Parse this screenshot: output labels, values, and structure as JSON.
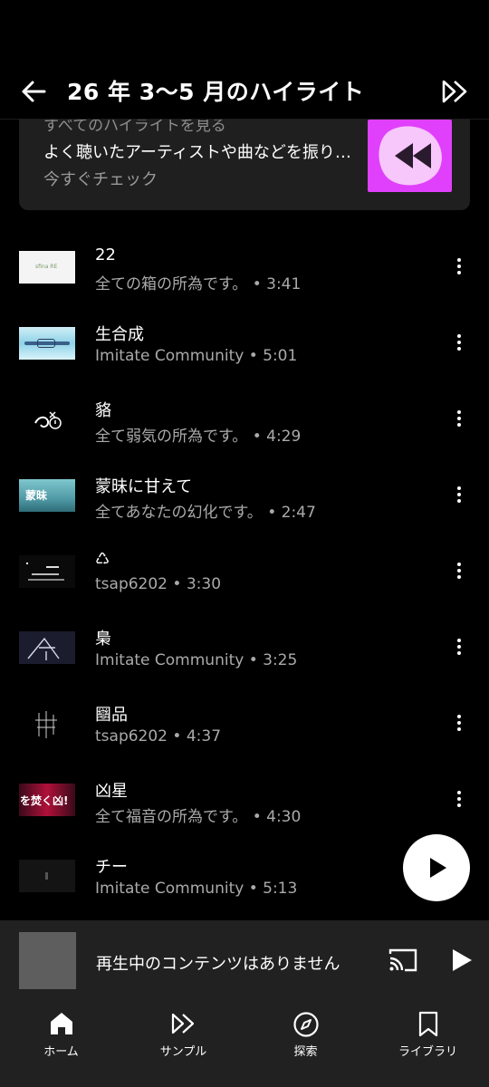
{
  "header": {
    "title": "26 年 3〜5 月のハイライト",
    "back_icon": "arrow-left-icon",
    "action_icon": "fast-forward-icon"
  },
  "highlight_card": {
    "overline": "すべてのハイライトを見る",
    "description": "よく聴いたアーティストや曲などを振り返る",
    "cta": "今すぐチェック",
    "art_color": "#e040fb",
    "art_icon": "rewind-icon"
  },
  "tracks": [
    {
      "title": "22",
      "subtitle": "全ての箱の所為です。 • 3:41"
    },
    {
      "title": "生合成",
      "subtitle": "Imitate Community • 5:01"
    },
    {
      "title": "貉",
      "subtitle": "全て弱気の所為です。 • 4:29"
    },
    {
      "title": "蒙昧に甘えて",
      "subtitle": "全てあなたの幻化です。 • 2:47"
    },
    {
      "title": "♺",
      "subtitle": "tsap6202 • 3:30"
    },
    {
      "title": "梟",
      "subtitle": "Imitate Community • 3:25"
    },
    {
      "title": "圝品",
      "subtitle": "tsap6202 • 4:37"
    },
    {
      "title": "凶星",
      "subtitle": "全て福音の所為です。 • 4:30"
    },
    {
      "title": "チー",
      "subtitle": "Imitate Community • 5:13"
    }
  ],
  "thumbs": {
    "t1_text": "sfina RE",
    "t4_text": "蒙昧",
    "t8_text": "を焚く凶!"
  },
  "mini_player": {
    "text": "再生中のコンテンツはありません",
    "cast_icon": "cast-icon",
    "play_icon": "play-icon"
  },
  "nav": {
    "items": [
      {
        "label": "ホーム",
        "icon": "home-icon"
      },
      {
        "label": "サンプル",
        "icon": "samples-icon"
      },
      {
        "label": "探索",
        "icon": "compass-icon"
      },
      {
        "label": "ライブラリ",
        "icon": "bookmark-icon"
      }
    ]
  },
  "colors": {
    "background": "#000000",
    "surface": "#1f1f1f",
    "bar": "#212121",
    "secondary_text": "#aaaaaa",
    "accent": "#e040fb"
  }
}
